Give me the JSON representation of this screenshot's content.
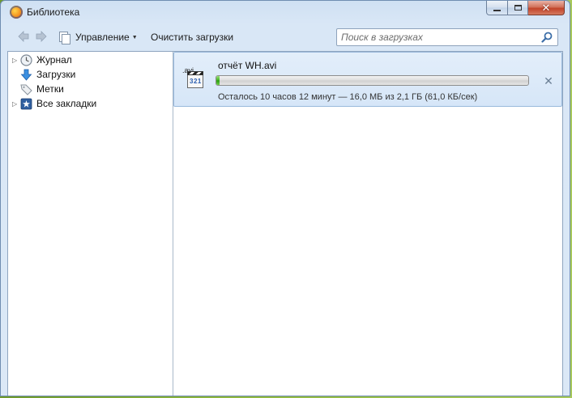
{
  "window": {
    "title": "Библиотека",
    "app_icon": "firefox-icon"
  },
  "toolbar": {
    "back_icon": "back-arrow-icon",
    "forward_icon": "forward-arrow-icon",
    "manage_label": "Управление",
    "clear_label": "Очистить загрузки",
    "search_placeholder": "Поиск в загрузках"
  },
  "sidebar": {
    "items": [
      {
        "label": "Журнал",
        "icon": "history-clock-icon",
        "expandable": true
      },
      {
        "label": "Загрузки",
        "icon": "download-arrow-icon",
        "expandable": false,
        "selected": true
      },
      {
        "label": "Метки",
        "icon": "tag-icon",
        "expandable": false
      },
      {
        "label": "Все закладки",
        "icon": "bookmarks-star-icon",
        "expandable": true
      }
    ]
  },
  "downloads": [
    {
      "file_ext": ".avi",
      "icon_number": "321",
      "name": "отчёт WH.avi",
      "progress": 0.008,
      "status": "Осталось 10 часов 12 минут — 16,0 МБ из 2,1 ГБ (61,0 КБ/сек)"
    }
  ],
  "colors": {
    "progress_green": "#3eb21e",
    "selection_bg": "#d6e6f8",
    "window_frame": "#dbe8f6"
  }
}
